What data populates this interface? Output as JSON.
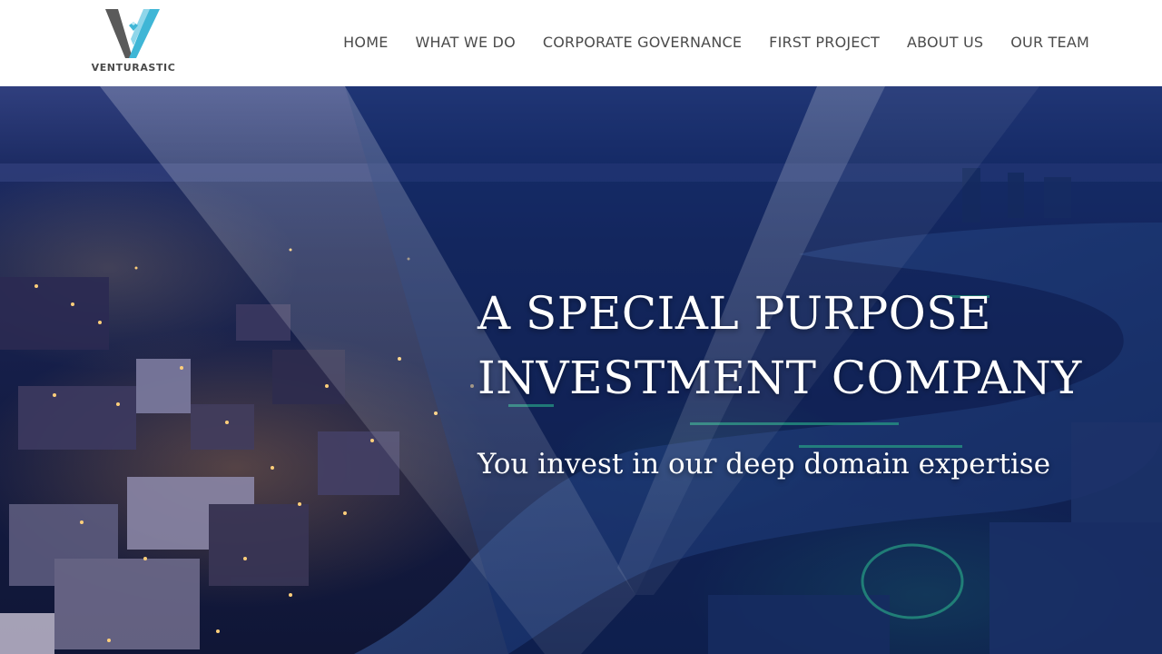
{
  "brand": {
    "name": "VENTURASTIC",
    "logo_icon": "v-diamond-logo-icon",
    "colors": {
      "v_dark": "#555555",
      "v_light": "#3fb6d6",
      "text": "#4a4a4a"
    }
  },
  "nav": {
    "items": [
      {
        "label": "HOME"
      },
      {
        "label": "WHAT WE DO"
      },
      {
        "label": "CORPORATE GOVERNANCE"
      },
      {
        "label": "FIRST PROJECT"
      },
      {
        "label": "ABOUT US"
      },
      {
        "label": "OUR TEAM"
      }
    ]
  },
  "hero": {
    "title": "A SPECIAL PURPOSE\nINVESTMENT COMPANY",
    "subtitle": "You invest in our deep domain expertise",
    "background": "aerial-city-night-photo",
    "colors": {
      "overlay": "#0d2a6b",
      "text": "#ffffff"
    }
  }
}
